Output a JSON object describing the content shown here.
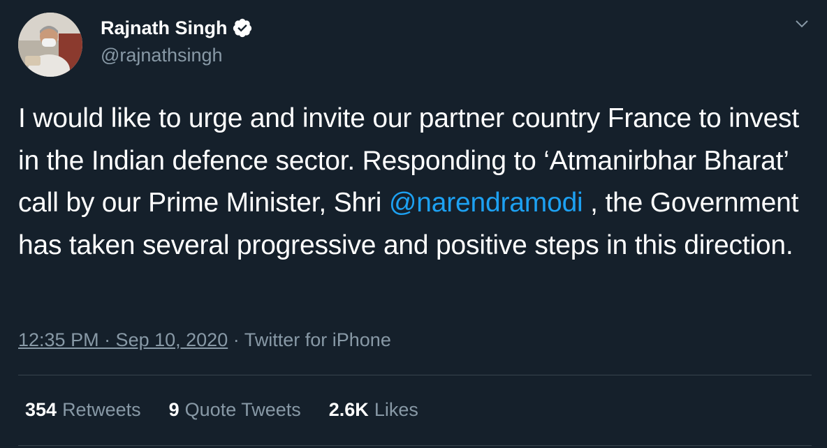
{
  "author": {
    "name": "Rajnath Singh",
    "handle": "@rajnathsingh",
    "verified": true
  },
  "tweet": {
    "text_before_mention": "I would like to urge and invite our partner country France to invest in the Indian defence sector. Responding to ‘Atmanirbhar Bharat’ call by our Prime Minister, Shri ",
    "mention": "@narendramodi",
    "text_after_mention": " , the Government has taken several progressive and positive steps in this direction."
  },
  "meta": {
    "timestamp": "12:35 PM · Sep 10, 2020",
    "separator": "·",
    "source": "Twitter for iPhone"
  },
  "stats": {
    "retweets_count": "354",
    "retweets_label": "Retweets",
    "quotes_count": "9",
    "quotes_label": "Quote Tweets",
    "likes_count": "2.6K",
    "likes_label": "Likes"
  },
  "colors": {
    "background": "#15202b",
    "text": "#ffffff",
    "secondary": "#8899a6",
    "link": "#1da1f2",
    "divider": "#38444d"
  },
  "icons": {
    "verified": "verified-badge-icon",
    "more": "chevron-down-icon"
  }
}
